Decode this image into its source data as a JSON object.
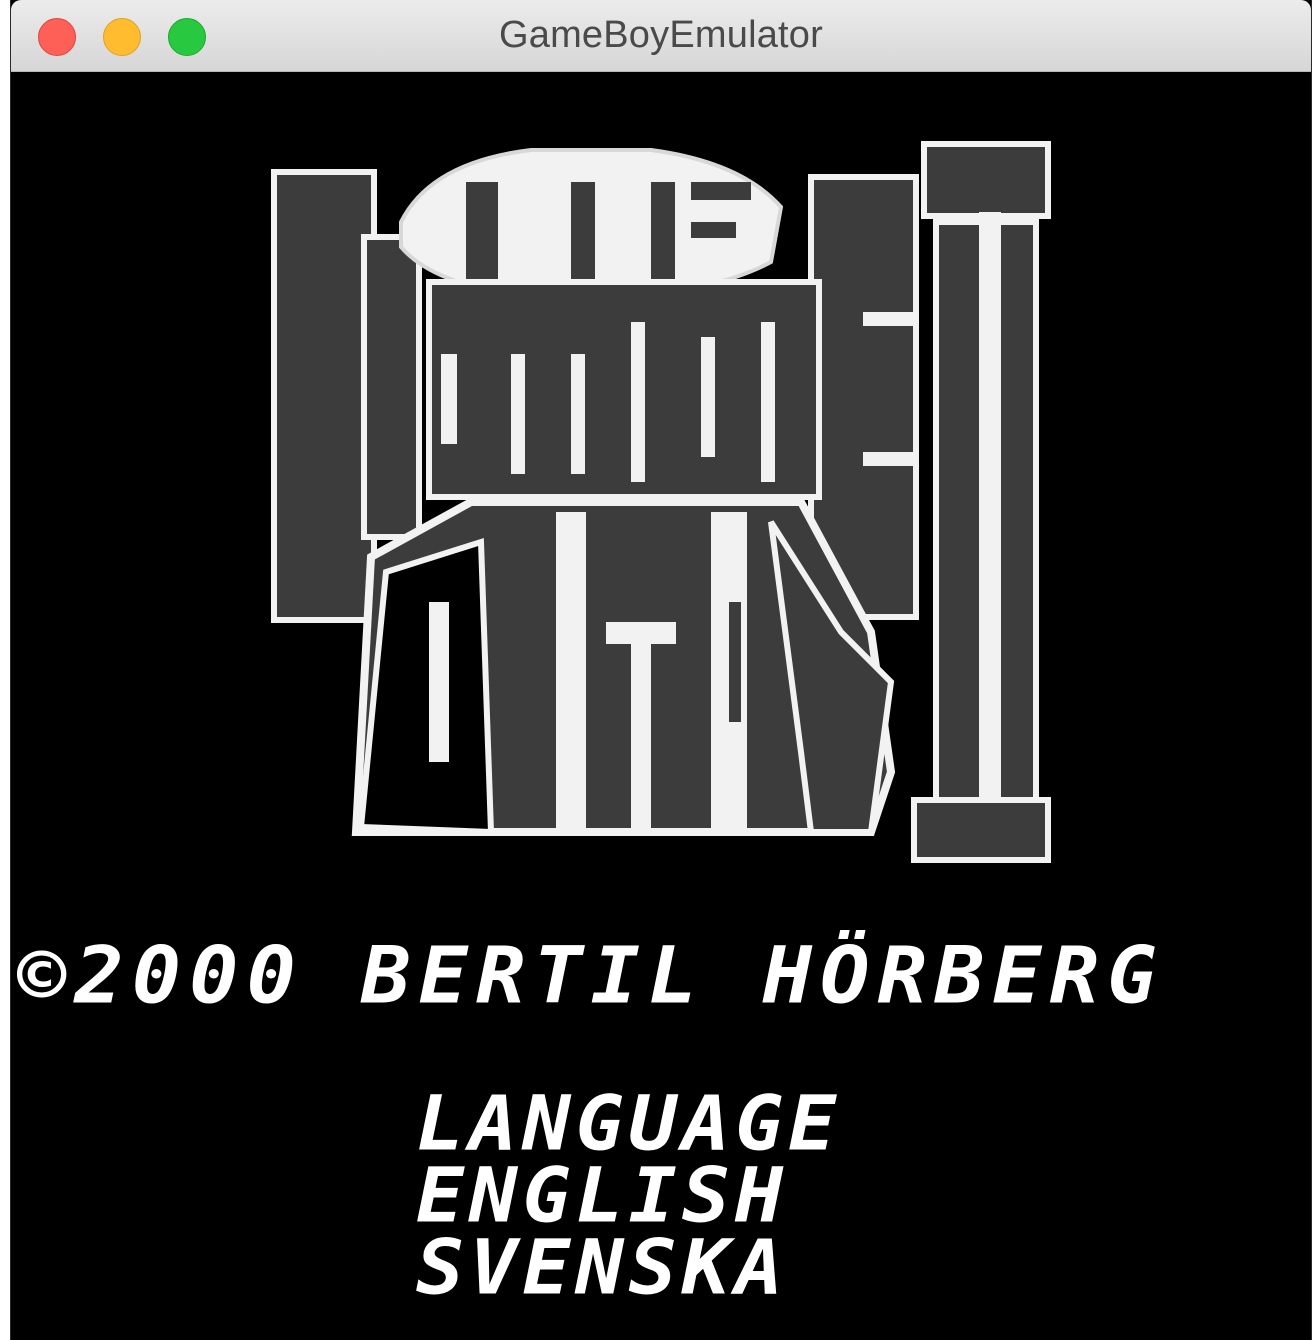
{
  "window": {
    "title": "GameBoyEmulator"
  },
  "game_screen": {
    "logo_text": "THE HORRIBLE DEMON II",
    "copyright": "©2000 BERTIL HÖRBERG",
    "menu": {
      "heading": "LANGUAGE",
      "options": [
        "ENGLISH",
        "SVENSKA"
      ]
    }
  },
  "colors": {
    "screen_background": "#000000",
    "logo_dark": "#3c3c3c",
    "logo_light": "#f2f2f2",
    "text": "#ffffff"
  }
}
